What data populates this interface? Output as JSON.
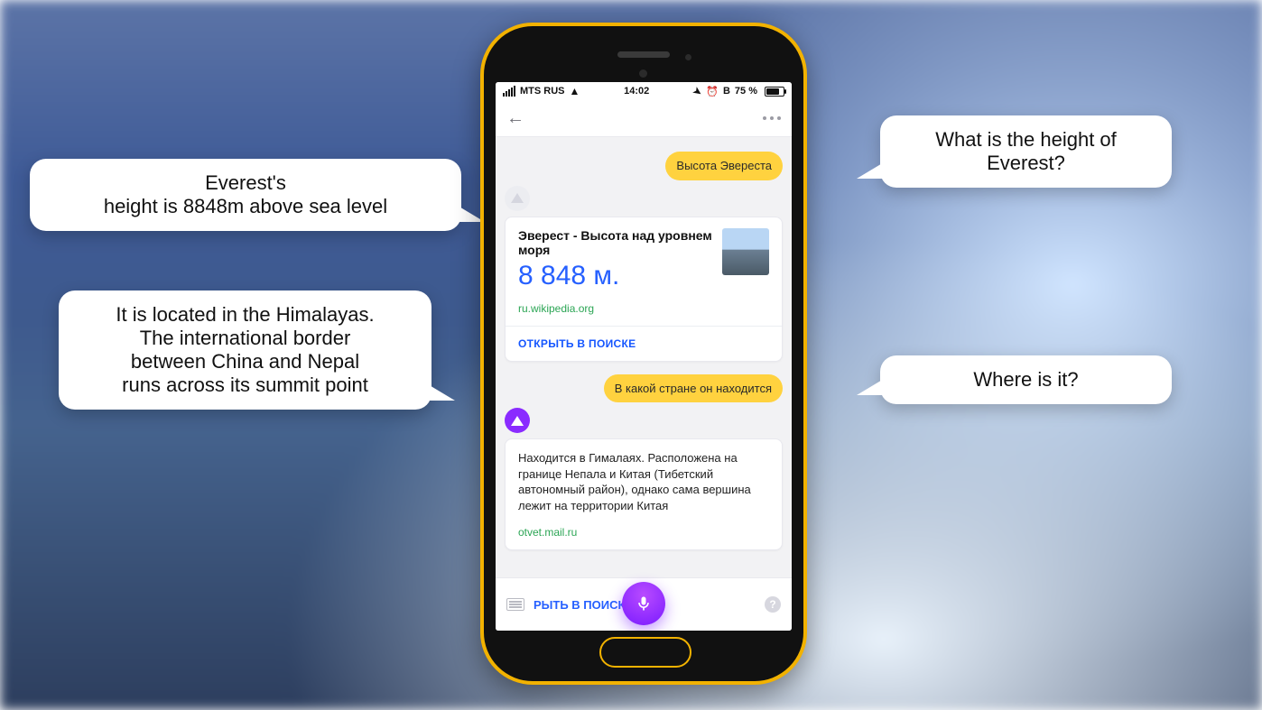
{
  "status": {
    "carrier": "MTS RUS",
    "time": "14:02",
    "battery_pct": "75 %"
  },
  "chat": {
    "user1": "Высота Эвереста",
    "card1": {
      "title": "Эверест - Высота над уровнем моря",
      "value": "8 848 м.",
      "source": "ru.wikipedia.org",
      "open": "ОТКРЫТЬ В ПОИСКЕ"
    },
    "user2": "В какой стране он находится",
    "card2": {
      "body": "Находится в Гималаях. Расположена на границе Непала и Китая (Тибетский автономный район), однако сама вершина лежит на территории Китая",
      "source": "otvet.mail.ru"
    }
  },
  "inputbar": {
    "hint": "РЫТЬ В ПОИСКЕ",
    "help": "?"
  },
  "callouts": {
    "c_top_right_l1": "What is the height of",
    "c_top_right_l2": "Everest?",
    "c_top_left_l1": "Everest's",
    "c_top_left_l2": "height is 8848m above sea level",
    "c_mid_right": "Where is it?",
    "c_bot_left_l1": "It is located in the Himalayas.",
    "c_bot_left_l2": "The international border",
    "c_bot_left_l3": "between China and Nepal",
    "c_bot_left_l4": "runs across its summit point"
  }
}
